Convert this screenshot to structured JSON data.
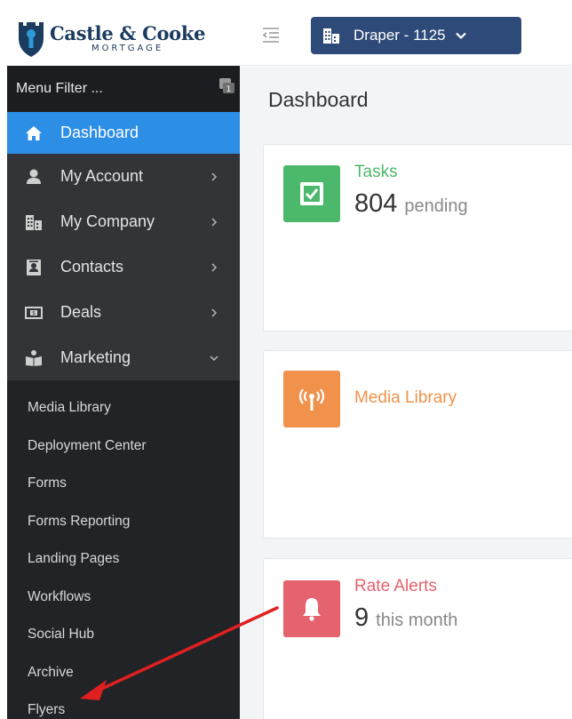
{
  "brand": {
    "name": "Castle & Cooke",
    "sub": "MORTGAGE"
  },
  "header": {
    "location_label": "Draper - 1125"
  },
  "sidebar": {
    "filter_placeholder": "Menu Filter ...",
    "items": [
      {
        "label": "Dashboard",
        "icon": "home-icon",
        "active": true
      },
      {
        "label": "My Account",
        "icon": "user-icon"
      },
      {
        "label": "My Company",
        "icon": "building-icon"
      },
      {
        "label": "Contacts",
        "icon": "contacts-icon"
      },
      {
        "label": "Deals",
        "icon": "deals-icon"
      },
      {
        "label": "Marketing",
        "icon": "marketing-icon",
        "expanded": true
      }
    ],
    "sub_items": [
      "Media Library",
      "Deployment Center",
      "Forms",
      "Forms Reporting",
      "Landing Pages",
      "Workflows",
      "Social Hub",
      "Archive",
      "Flyers"
    ]
  },
  "main": {
    "title": "Dashboard",
    "cards": [
      {
        "title": "Tasks",
        "count": "804",
        "unit": "pending",
        "color": "#4cb86b",
        "title_color": "#4cb86b"
      },
      {
        "title": "Media Library",
        "count": "",
        "unit": "",
        "color": "#f0924c",
        "title_color": "#f0924c"
      },
      {
        "title": "Rate Alerts",
        "count": "9",
        "unit": "this month",
        "color": "#e5626f",
        "title_color": "#e5626f"
      }
    ]
  },
  "colors": {
    "sidebar_bg": "#222326",
    "active_item": "#2d8ee6",
    "header_button": "#2e4a78",
    "annotation_arrow": "#e02020"
  }
}
